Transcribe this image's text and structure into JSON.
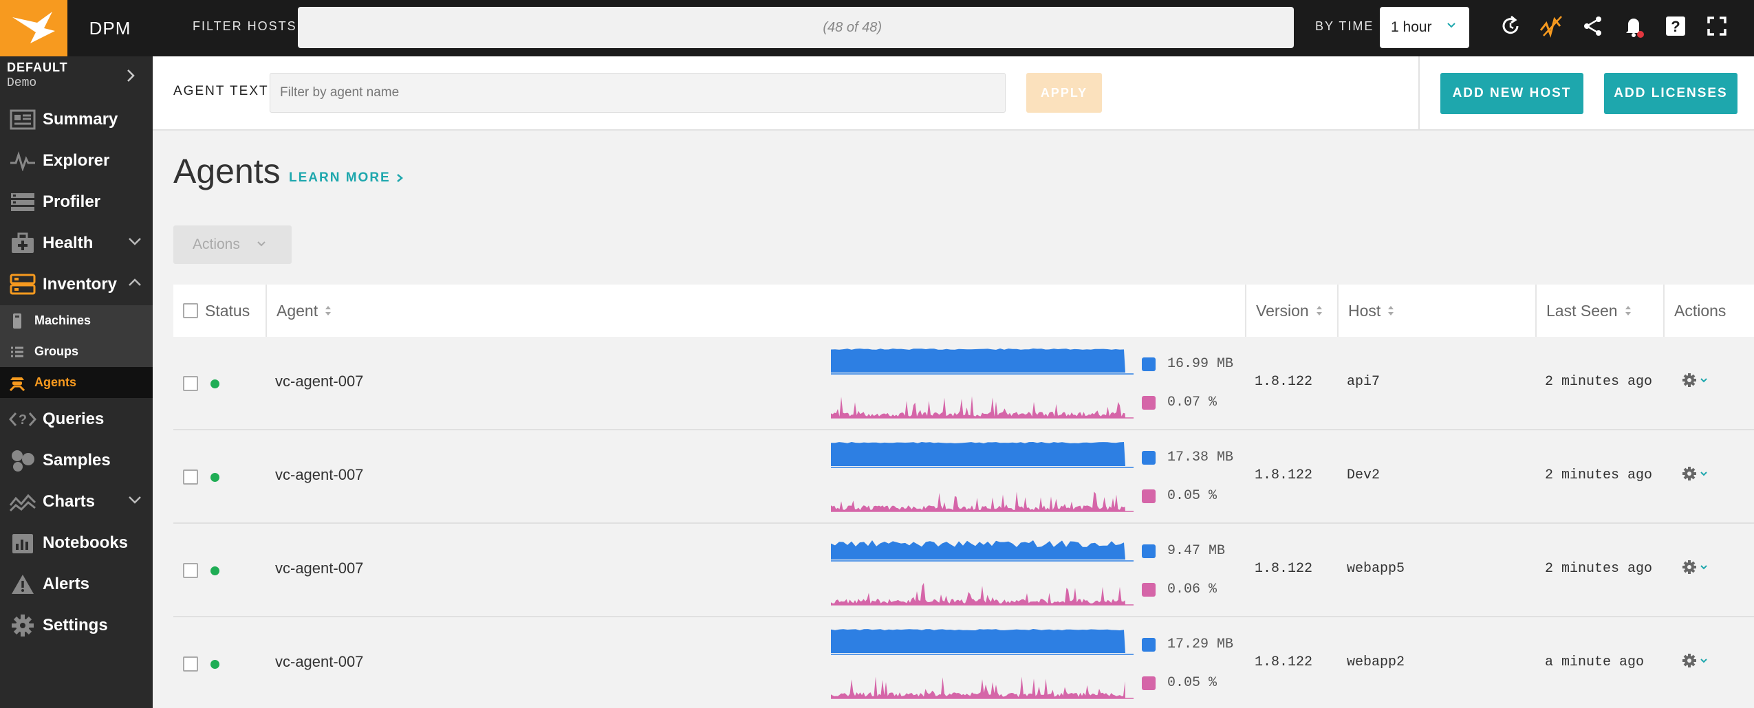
{
  "topbar": {
    "brand": "DPM",
    "filter_label": "FILTER HOSTS",
    "filter_count": "(48 of 48)",
    "bytime_label": "BY TIME",
    "time_value": "1 hour"
  },
  "sidebar": {
    "env_name": "DEFAULT",
    "env_sub": "Demo",
    "items": [
      {
        "label": "Summary",
        "icon": "summary-icon"
      },
      {
        "label": "Explorer",
        "icon": "explorer-icon"
      },
      {
        "label": "Profiler",
        "icon": "profiler-icon"
      },
      {
        "label": "Health",
        "icon": "health-icon"
      },
      {
        "label": "Inventory",
        "icon": "inventory-icon"
      },
      {
        "label": "Queries",
        "icon": "queries-icon"
      },
      {
        "label": "Samples",
        "icon": "samples-icon"
      },
      {
        "label": "Charts",
        "icon": "charts-icon"
      },
      {
        "label": "Notebooks",
        "icon": "notebooks-icon"
      },
      {
        "label": "Alerts",
        "icon": "alerts-icon"
      },
      {
        "label": "Settings",
        "icon": "settings-icon"
      }
    ],
    "inventory_sub": [
      {
        "label": "Machines",
        "icon": "machine-icon"
      },
      {
        "label": "Groups",
        "icon": "groups-icon"
      },
      {
        "label": "Agents",
        "icon": "agents-icon"
      }
    ]
  },
  "agentbar": {
    "label": "AGENT TEXT",
    "placeholder": "Filter by agent name",
    "apply": "APPLY",
    "add_host": "ADD NEW HOST",
    "add_licenses": "ADD LICENSES"
  },
  "page": {
    "title": "Agents",
    "learn_more": "LEARN MORE",
    "actions_label": "Actions"
  },
  "table": {
    "headers": {
      "status": "Status",
      "agent": "Agent",
      "version": "Version",
      "host": "Host",
      "last_seen": "Last Seen",
      "actions": "Actions"
    },
    "rows": [
      {
        "agent": "vc-agent-007",
        "memory": "16.99 MB",
        "cpu": "0.07 %",
        "version": "1.8.122",
        "host": "api7",
        "last_seen": "2 minutes ago"
      },
      {
        "agent": "vc-agent-007",
        "memory": "17.38 MB",
        "cpu": "0.05 %",
        "version": "1.8.122",
        "host": "Dev2",
        "last_seen": "2 minutes ago"
      },
      {
        "agent": "vc-agent-007",
        "memory": "9.47 MB",
        "cpu": "0.06 %",
        "version": "1.8.122",
        "host": "webapp5",
        "last_seen": "2 minutes ago"
      },
      {
        "agent": "vc-agent-007",
        "memory": "17.29 MB",
        "cpu": "0.05 %",
        "version": "1.8.122",
        "host": "webapp2",
        "last_seen": "a minute ago"
      }
    ]
  },
  "colors": {
    "accent_orange": "#f79a1f",
    "teal": "#1ea7ad",
    "memory_blue": "#2d7fe3",
    "cpu_pink": "#d565a8",
    "status_green": "#1fad55"
  }
}
